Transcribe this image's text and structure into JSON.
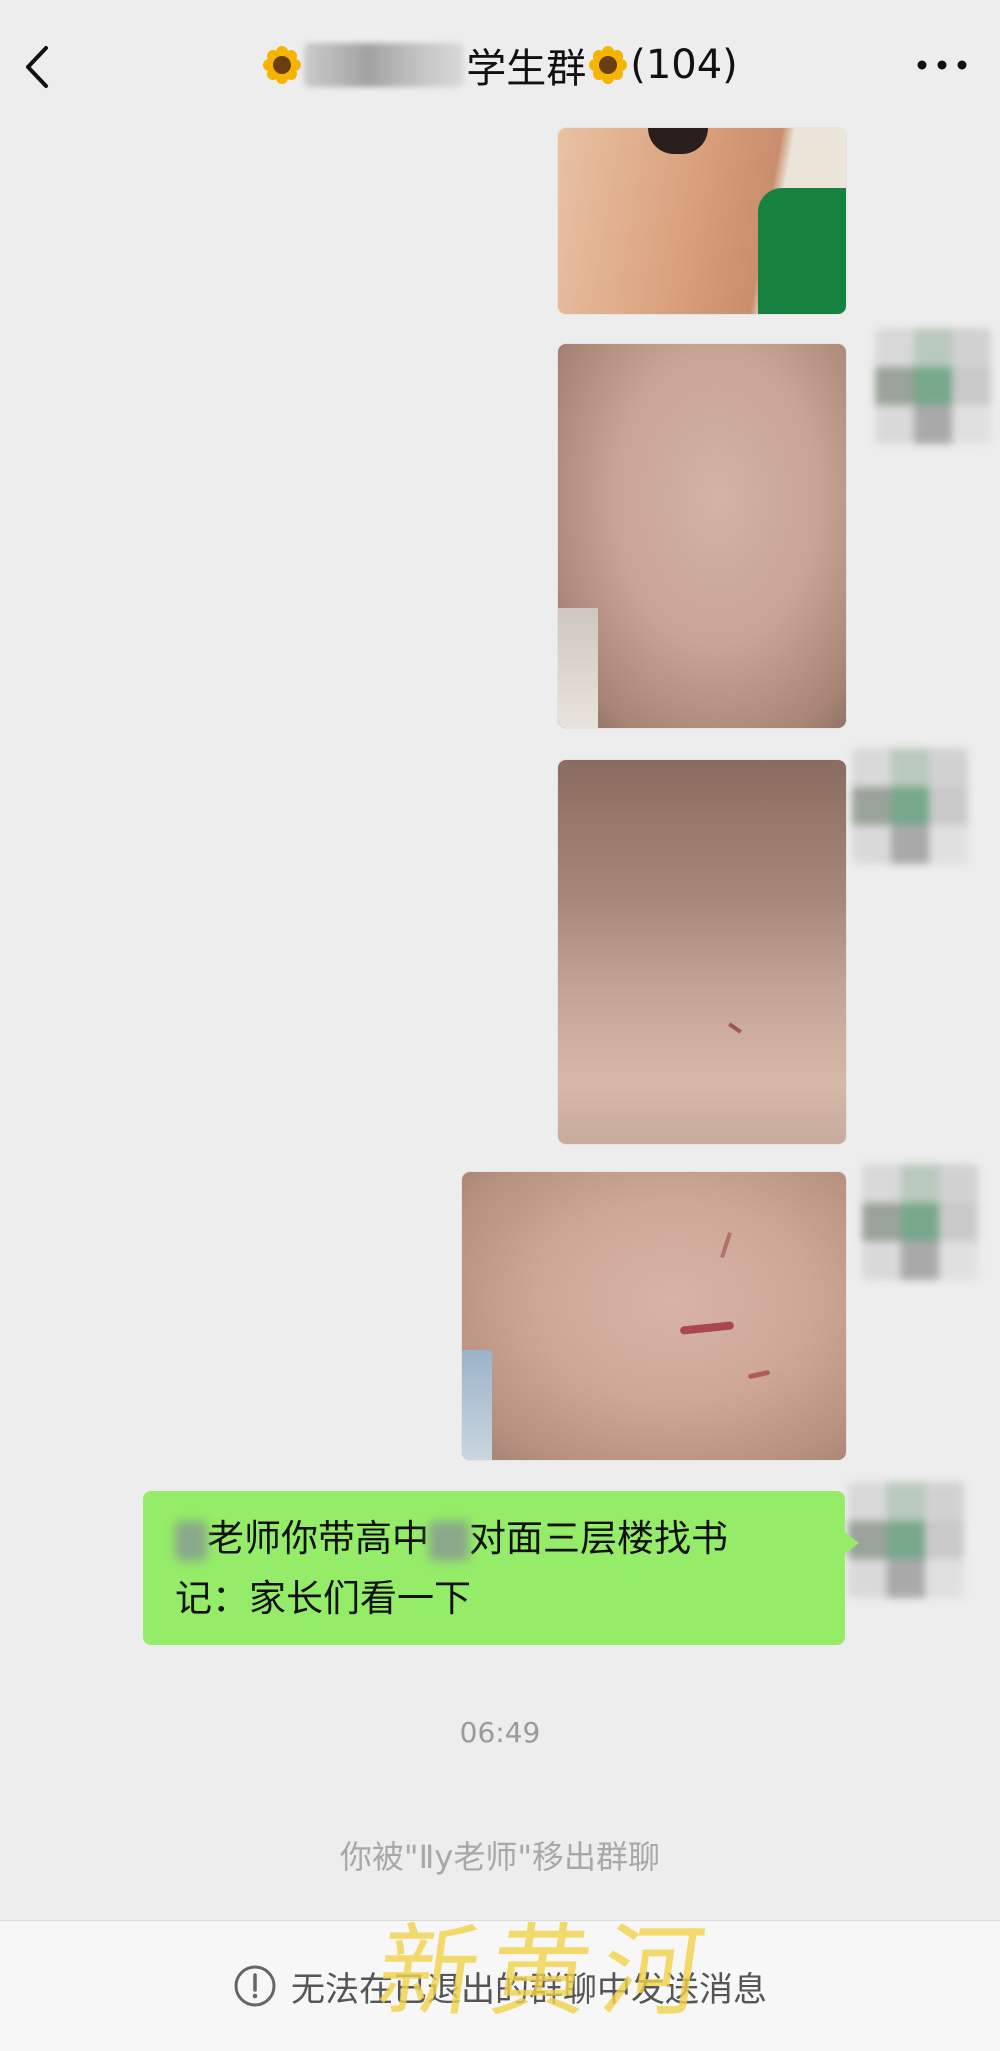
{
  "header": {
    "title_visible_text": "学生群",
    "member_count": "(104)"
  },
  "messages": [
    {
      "type": "image",
      "description": "shoulder photo"
    },
    {
      "type": "image",
      "description": "arm photo"
    },
    {
      "type": "image",
      "description": "arm photo"
    },
    {
      "type": "image",
      "description": "arm photo with scratch"
    },
    {
      "type": "text",
      "line1_visible": "老师你带高中",
      "line1_rest": "对面三层楼找书",
      "line2": "记：家长们看一下"
    }
  ],
  "timestamp": "06:49",
  "system_notice": "你被\"Ⅱy老师\"移出群聊",
  "bottom_bar": {
    "notice": "无法在已退出的群聊中发送消息"
  },
  "watermark": "新黄河",
  "colors": {
    "background": "#ededed",
    "bubble_green": "#95ec69",
    "notice_gray": "#a8a8a8"
  }
}
